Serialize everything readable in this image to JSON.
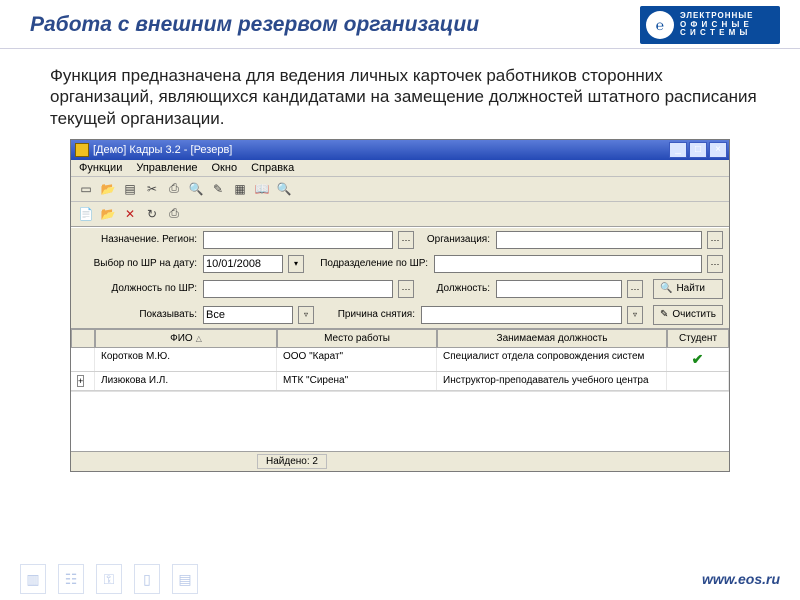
{
  "slide": {
    "title": "Работа с внешним резервом организации",
    "intro": "Функция предназначена для ведения личных карточек работников сторонних организаций, являющихся кандидатами на замещение должностей штатного расписания текущей организации.",
    "brand_line1": "ЭЛЕКТРОННЫЕ",
    "brand_line2": "О Ф И С Н Ы Е",
    "brand_line3": "С И С Т Е М Ы",
    "brand_glyph": "℮",
    "footer_url": "www.eos.ru"
  },
  "window": {
    "title": "[Демо] Кадры 3.2 - [Резерв]"
  },
  "menu": {
    "items": [
      "Функции",
      "Управление",
      "Окно",
      "Справка"
    ]
  },
  "form": {
    "region_label": "Назначение. Регион:",
    "org_label": "Организация:",
    "date_label": "Выбор по ШР на дату:",
    "date_value": "10/01/2008",
    "dept_label": "Подразделение по ШР:",
    "post_label": "Должность по ШР:",
    "dolzh_label": "Должность:",
    "show_label": "Показывать:",
    "show_value": "Все",
    "reason_label": "Причина снятия:",
    "find_btn": "Найти",
    "find_icon": "🔍",
    "clear_btn": "Очистить",
    "clear_icon": "✎"
  },
  "table": {
    "headers": {
      "fio": "ФИО",
      "place": "Место работы",
      "post": "Занимаемая должность",
      "student": "Студент"
    },
    "rows": [
      {
        "fio": "Коротков М.Ю.",
        "place": "ООО \"Карат\"",
        "post": "Специалист отдела сопровождения систем",
        "student": true
      },
      {
        "fio": "Лизюкова И.Л.",
        "place": "МТК \"Сирена\"",
        "post": "Инструктор-преподаватель учебного центра",
        "student": false
      }
    ]
  },
  "status": {
    "found": "Найдено: 2"
  },
  "win_ctrl": {
    "min": "_",
    "restore": "□",
    "close": "×"
  },
  "icons": {
    "new": "▭",
    "open": "📂",
    "card": "▤",
    "cut": "✂",
    "print": "⎙",
    "find": "🔍",
    "edit": "✎",
    "book": "📖",
    "grid": "▦",
    "zoom": "🔍",
    "doc_new": "📄",
    "del": "✕",
    "refresh": "↻",
    "print2": "⎙",
    "expand": "+"
  }
}
